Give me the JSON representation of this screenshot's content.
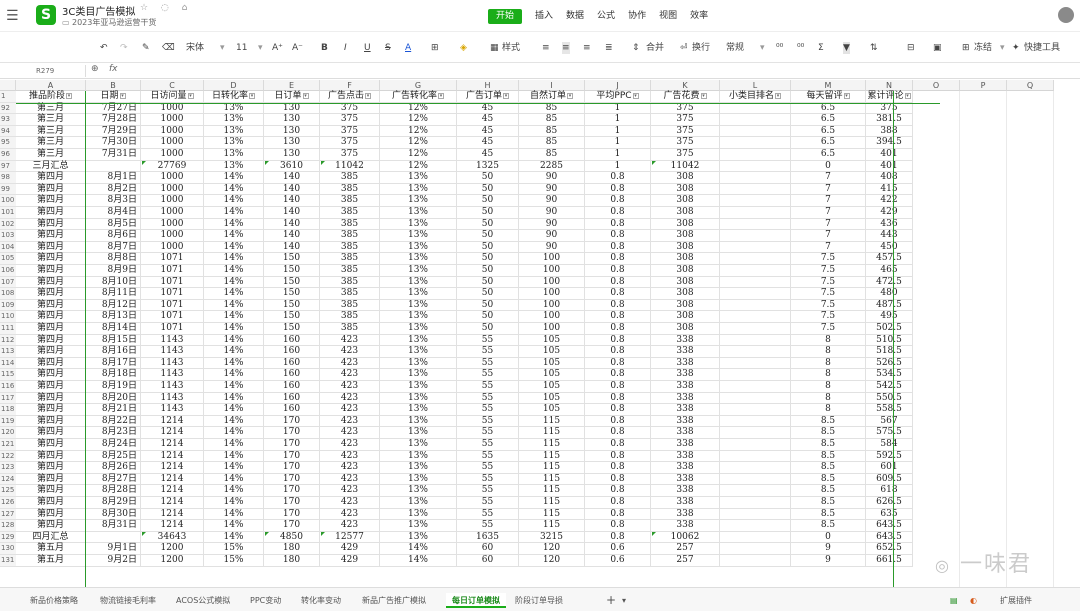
{
  "title_bar": {
    "menu_icon": "menu-icon",
    "app_logo": "S",
    "doc_title": "3C类目广告模拟",
    "title_icons": "☆ ◌ ⌂",
    "doc_path": "2023年亚马逊运营干货"
  },
  "ribbon_tabs": [
    "开始",
    "插入",
    "数据",
    "公式",
    "协作",
    "视图",
    "效率"
  ],
  "toolbar": {
    "font_name": "宋体",
    "font_size": "11",
    "style": "样式",
    "merge": "合并",
    "wrap": "换行",
    "number_format": "常规",
    "freeze": "冻结",
    "quick_tools": "快捷工具"
  },
  "formula_bar": {
    "cell_ref": "R279",
    "fx": "fx"
  },
  "columns": [
    "A",
    "B",
    "C",
    "D",
    "E",
    "F",
    "G",
    "H",
    "I",
    "J",
    "K",
    "L",
    "M",
    "N",
    "O",
    "P",
    "Q"
  ],
  "headers": [
    "推品阶段",
    "日期",
    "日访问量",
    "日转化率",
    "日订单",
    "广告点击",
    "广告转化率",
    "广告订单",
    "自然订单",
    "平均PPC",
    "广告花费",
    "小类目排名",
    "每天留评",
    "累计评论"
  ],
  "header_row_num": "1",
  "rows": [
    {
      "n": "92",
      "cells": [
        "第三月",
        "7月27日",
        "1000",
        "13%",
        "130",
        "375",
        "12%",
        "45",
        "85",
        "1",
        "375",
        "",
        "6.5",
        "375"
      ]
    },
    {
      "n": "93",
      "cells": [
        "第三月",
        "7月28日",
        "1000",
        "13%",
        "130",
        "375",
        "12%",
        "45",
        "85",
        "1",
        "375",
        "",
        "6.5",
        "381.5"
      ]
    },
    {
      "n": "94",
      "cells": [
        "第三月",
        "7月29日",
        "1000",
        "13%",
        "130",
        "375",
        "12%",
        "45",
        "85",
        "1",
        "375",
        "",
        "6.5",
        "388"
      ]
    },
    {
      "n": "95",
      "cells": [
        "第三月",
        "7月30日",
        "1000",
        "13%",
        "130",
        "375",
        "12%",
        "45",
        "85",
        "1",
        "375",
        "",
        "6.5",
        "394.5"
      ]
    },
    {
      "n": "96",
      "cells": [
        "第三月",
        "7月31日",
        "1000",
        "13%",
        "130",
        "375",
        "12%",
        "45",
        "85",
        "1",
        "375",
        "",
        "6.5",
        "401"
      ]
    },
    {
      "n": "97",
      "cells": [
        "三月汇总",
        "",
        "27769",
        "13%",
        "3610",
        "11042",
        "12%",
        "1325",
        "2285",
        "1",
        "11042",
        "",
        "0",
        "401"
      ]
    },
    {
      "n": "98",
      "cells": [
        "第四月",
        "8月1日",
        "1000",
        "14%",
        "140",
        "385",
        "13%",
        "50",
        "90",
        "0.8",
        "308",
        "",
        "7",
        "408"
      ]
    },
    {
      "n": "99",
      "cells": [
        "第四月",
        "8月2日",
        "1000",
        "14%",
        "140",
        "385",
        "13%",
        "50",
        "90",
        "0.8",
        "308",
        "",
        "7",
        "415"
      ]
    },
    {
      "n": "100",
      "cells": [
        "第四月",
        "8月3日",
        "1000",
        "14%",
        "140",
        "385",
        "13%",
        "50",
        "90",
        "0.8",
        "308",
        "",
        "7",
        "422"
      ]
    },
    {
      "n": "101",
      "cells": [
        "第四月",
        "8月4日",
        "1000",
        "14%",
        "140",
        "385",
        "13%",
        "50",
        "90",
        "0.8",
        "308",
        "",
        "7",
        "429"
      ]
    },
    {
      "n": "102",
      "cells": [
        "第四月",
        "8月5日",
        "1000",
        "14%",
        "140",
        "385",
        "13%",
        "50",
        "90",
        "0.8",
        "308",
        "",
        "7",
        "436"
      ]
    },
    {
      "n": "103",
      "cells": [
        "第四月",
        "8月6日",
        "1000",
        "14%",
        "140",
        "385",
        "13%",
        "50",
        "90",
        "0.8",
        "308",
        "",
        "7",
        "443"
      ]
    },
    {
      "n": "104",
      "cells": [
        "第四月",
        "8月7日",
        "1000",
        "14%",
        "140",
        "385",
        "13%",
        "50",
        "90",
        "0.8",
        "308",
        "",
        "7",
        "450"
      ]
    },
    {
      "n": "105",
      "cells": [
        "第四月",
        "8月8日",
        "1071",
        "14%",
        "150",
        "385",
        "13%",
        "50",
        "100",
        "0.8",
        "308",
        "",
        "7.5",
        "457.5"
      ]
    },
    {
      "n": "106",
      "cells": [
        "第四月",
        "8月9日",
        "1071",
        "14%",
        "150",
        "385",
        "13%",
        "50",
        "100",
        "0.8",
        "308",
        "",
        "7.5",
        "465"
      ]
    },
    {
      "n": "107",
      "cells": [
        "第四月",
        "8月10日",
        "1071",
        "14%",
        "150",
        "385",
        "13%",
        "50",
        "100",
        "0.8",
        "308",
        "",
        "7.5",
        "472.5"
      ]
    },
    {
      "n": "108",
      "cells": [
        "第四月",
        "8月11日",
        "1071",
        "14%",
        "150",
        "385",
        "13%",
        "50",
        "100",
        "0.8",
        "308",
        "",
        "7.5",
        "480"
      ]
    },
    {
      "n": "109",
      "cells": [
        "第四月",
        "8月12日",
        "1071",
        "14%",
        "150",
        "385",
        "13%",
        "50",
        "100",
        "0.8",
        "308",
        "",
        "7.5",
        "487.5"
      ]
    },
    {
      "n": "110",
      "cells": [
        "第四月",
        "8月13日",
        "1071",
        "14%",
        "150",
        "385",
        "13%",
        "50",
        "100",
        "0.8",
        "308",
        "",
        "7.5",
        "495"
      ]
    },
    {
      "n": "111",
      "cells": [
        "第四月",
        "8月14日",
        "1071",
        "14%",
        "150",
        "385",
        "13%",
        "50",
        "100",
        "0.8",
        "308",
        "",
        "7.5",
        "502.5"
      ]
    },
    {
      "n": "112",
      "cells": [
        "第四月",
        "8月15日",
        "1143",
        "14%",
        "160",
        "423",
        "13%",
        "55",
        "105",
        "0.8",
        "338",
        "",
        "8",
        "510.5"
      ]
    },
    {
      "n": "113",
      "cells": [
        "第四月",
        "8月16日",
        "1143",
        "14%",
        "160",
        "423",
        "13%",
        "55",
        "105",
        "0.8",
        "338",
        "",
        "8",
        "518.5"
      ]
    },
    {
      "n": "114",
      "cells": [
        "第四月",
        "8月17日",
        "1143",
        "14%",
        "160",
        "423",
        "13%",
        "55",
        "105",
        "0.8",
        "338",
        "",
        "8",
        "526.5"
      ]
    },
    {
      "n": "115",
      "cells": [
        "第四月",
        "8月18日",
        "1143",
        "14%",
        "160",
        "423",
        "13%",
        "55",
        "105",
        "0.8",
        "338",
        "",
        "8",
        "534.5"
      ]
    },
    {
      "n": "116",
      "cells": [
        "第四月",
        "8月19日",
        "1143",
        "14%",
        "160",
        "423",
        "13%",
        "55",
        "105",
        "0.8",
        "338",
        "",
        "8",
        "542.5"
      ]
    },
    {
      "n": "117",
      "cells": [
        "第四月",
        "8月20日",
        "1143",
        "14%",
        "160",
        "423",
        "13%",
        "55",
        "105",
        "0.8",
        "338",
        "",
        "8",
        "550.5"
      ]
    },
    {
      "n": "118",
      "cells": [
        "第四月",
        "8月21日",
        "1143",
        "14%",
        "160",
        "423",
        "13%",
        "55",
        "105",
        "0.8",
        "338",
        "",
        "8",
        "558.5"
      ]
    },
    {
      "n": "119",
      "cells": [
        "第四月",
        "8月22日",
        "1214",
        "14%",
        "170",
        "423",
        "13%",
        "55",
        "115",
        "0.8",
        "338",
        "",
        "8.5",
        "567"
      ]
    },
    {
      "n": "120",
      "cells": [
        "第四月",
        "8月23日",
        "1214",
        "14%",
        "170",
        "423",
        "13%",
        "55",
        "115",
        "0.8",
        "338",
        "",
        "8.5",
        "575.5"
      ]
    },
    {
      "n": "121",
      "cells": [
        "第四月",
        "8月24日",
        "1214",
        "14%",
        "170",
        "423",
        "13%",
        "55",
        "115",
        "0.8",
        "338",
        "",
        "8.5",
        "584"
      ]
    },
    {
      "n": "122",
      "cells": [
        "第四月",
        "8月25日",
        "1214",
        "14%",
        "170",
        "423",
        "13%",
        "55",
        "115",
        "0.8",
        "338",
        "",
        "8.5",
        "592.5"
      ]
    },
    {
      "n": "123",
      "cells": [
        "第四月",
        "8月26日",
        "1214",
        "14%",
        "170",
        "423",
        "13%",
        "55",
        "115",
        "0.8",
        "338",
        "",
        "8.5",
        "601"
      ]
    },
    {
      "n": "124",
      "cells": [
        "第四月",
        "8月27日",
        "1214",
        "14%",
        "170",
        "423",
        "13%",
        "55",
        "115",
        "0.8",
        "338",
        "",
        "8.5",
        "609.5"
      ]
    },
    {
      "n": "125",
      "cells": [
        "第四月",
        "8月28日",
        "1214",
        "14%",
        "170",
        "423",
        "13%",
        "55",
        "115",
        "0.8",
        "338",
        "",
        "8.5",
        "618"
      ]
    },
    {
      "n": "126",
      "cells": [
        "第四月",
        "8月29日",
        "1214",
        "14%",
        "170",
        "423",
        "13%",
        "55",
        "115",
        "0.8",
        "338",
        "",
        "8.5",
        "626.5"
      ]
    },
    {
      "n": "127",
      "cells": [
        "第四月",
        "8月30日",
        "1214",
        "14%",
        "170",
        "423",
        "13%",
        "55",
        "115",
        "0.8",
        "338",
        "",
        "8.5",
        "635"
      ]
    },
    {
      "n": "128",
      "cells": [
        "第四月",
        "8月31日",
        "1214",
        "14%",
        "170",
        "423",
        "13%",
        "55",
        "115",
        "0.8",
        "338",
        "",
        "8.5",
        "643.5"
      ]
    },
    {
      "n": "129",
      "cells": [
        "四月汇总",
        "",
        "34643",
        "14%",
        "4850",
        "12577",
        "13%",
        "1635",
        "3215",
        "0.8",
        "10062",
        "",
        "0",
        "643.5"
      ]
    },
    {
      "n": "130",
      "cells": [
        "第五月",
        "9月1日",
        "1200",
        "15%",
        "180",
        "429",
        "14%",
        "60",
        "120",
        "0.6",
        "257",
        "",
        "9",
        "652.5"
      ]
    },
    {
      "n": "131",
      "cells": [
        "第五月",
        "9月2日",
        "1200",
        "15%",
        "180",
        "429",
        "14%",
        "60",
        "120",
        "0.6",
        "257",
        "",
        "9",
        "661.5"
      ]
    }
  ],
  "sheet_tabs": [
    "新品价格策略",
    "物流链接毛利率",
    "ACOS公式模拟",
    "PPC变动",
    "转化率变动",
    "新品广告推广模拟",
    "每日订单模拟",
    "阶段订单导损"
  ],
  "active_sheet": "每日订单模拟",
  "add_sheet": "+",
  "watermark": "一味君",
  "status_right": "扩展插件",
  "accent_color": "#1aad19"
}
